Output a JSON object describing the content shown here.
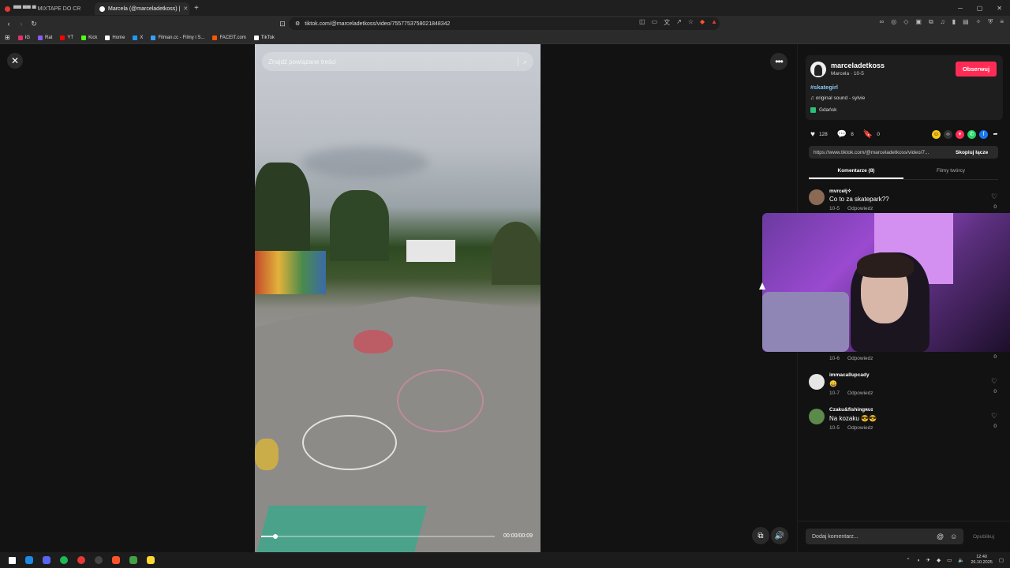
{
  "browser": {
    "tabs": [
      {
        "label": "▀▀ ▀▀ ▀ MIXTAPE DO CR",
        "color": "#e53935"
      },
      {
        "label": "Marcela (@marceladetkoss) |",
        "color": "#ffffff"
      }
    ],
    "new_tab": "+",
    "url": "tiktok.com/@marceladetkoss/video/7557753758021848342",
    "bookmarks": [
      {
        "label": "IG",
        "color": "#e1306c"
      },
      {
        "label": "Rat",
        "color": "#8a5cf5"
      },
      {
        "label": "YT",
        "color": "#ff0000"
      },
      {
        "label": "Kick",
        "color": "#53fc18"
      },
      {
        "label": "Home",
        "color": "#ffffff"
      },
      {
        "label": "X",
        "color": "#1d9bf0"
      },
      {
        "label": "Filman.cc - Filmy i S...",
        "color": "#39a0ff"
      },
      {
        "label": "FACEIT.com",
        "color": "#ff5500"
      },
      {
        "label": "TikTok",
        "color": "#ffffff"
      }
    ]
  },
  "video": {
    "search_placeholder": "Znajdź powiązane treści",
    "time": "00:00/00:09",
    "progress_fraction": 0.06
  },
  "post": {
    "username": "marceladetkoss",
    "subline": "Marcela · 10-5",
    "follow_label": "Obserwuj",
    "hashtag": "#skategirl",
    "sound": "original sound - sylvie",
    "location": "Gdańsk",
    "likes": "128",
    "comments": "8",
    "saves": "0",
    "link": "https://www.tiktok.com/@marceladetkoss/video/7...",
    "copy_link": "Skopiuj łącze",
    "tab_comments": "Komentarze (8)",
    "tab_creator": "Filmy twórcy"
  },
  "comments": [
    {
      "name": "mvrcełj✧",
      "text": "Co to za skatepark??",
      "date": "10-5",
      "reply": "Odpowiedz",
      "likes": "0"
    },
    {
      "name": "",
      "text": "",
      "date": "10-6",
      "reply": "Odpowiedz",
      "likes": "0"
    },
    {
      "name": "immacallupcady",
      "text": "😄",
      "date": "10-7",
      "reply": "Odpowiedz",
      "likes": "0"
    },
    {
      "name": "Czaku&fishingʀᴜɪ",
      "text": "Na kozaku 😎😎",
      "date": "10-5",
      "reply": "Odpowiedz",
      "likes": "0"
    }
  ],
  "comment_bar": {
    "placeholder": "Dodaj komentarz...",
    "publish": "Opublikuj"
  },
  "taskbar": {
    "time": "12:40",
    "date": "26.10.2025"
  },
  "colors": {
    "accent": "#fe2c55",
    "hashtag": "#86c6f0"
  }
}
